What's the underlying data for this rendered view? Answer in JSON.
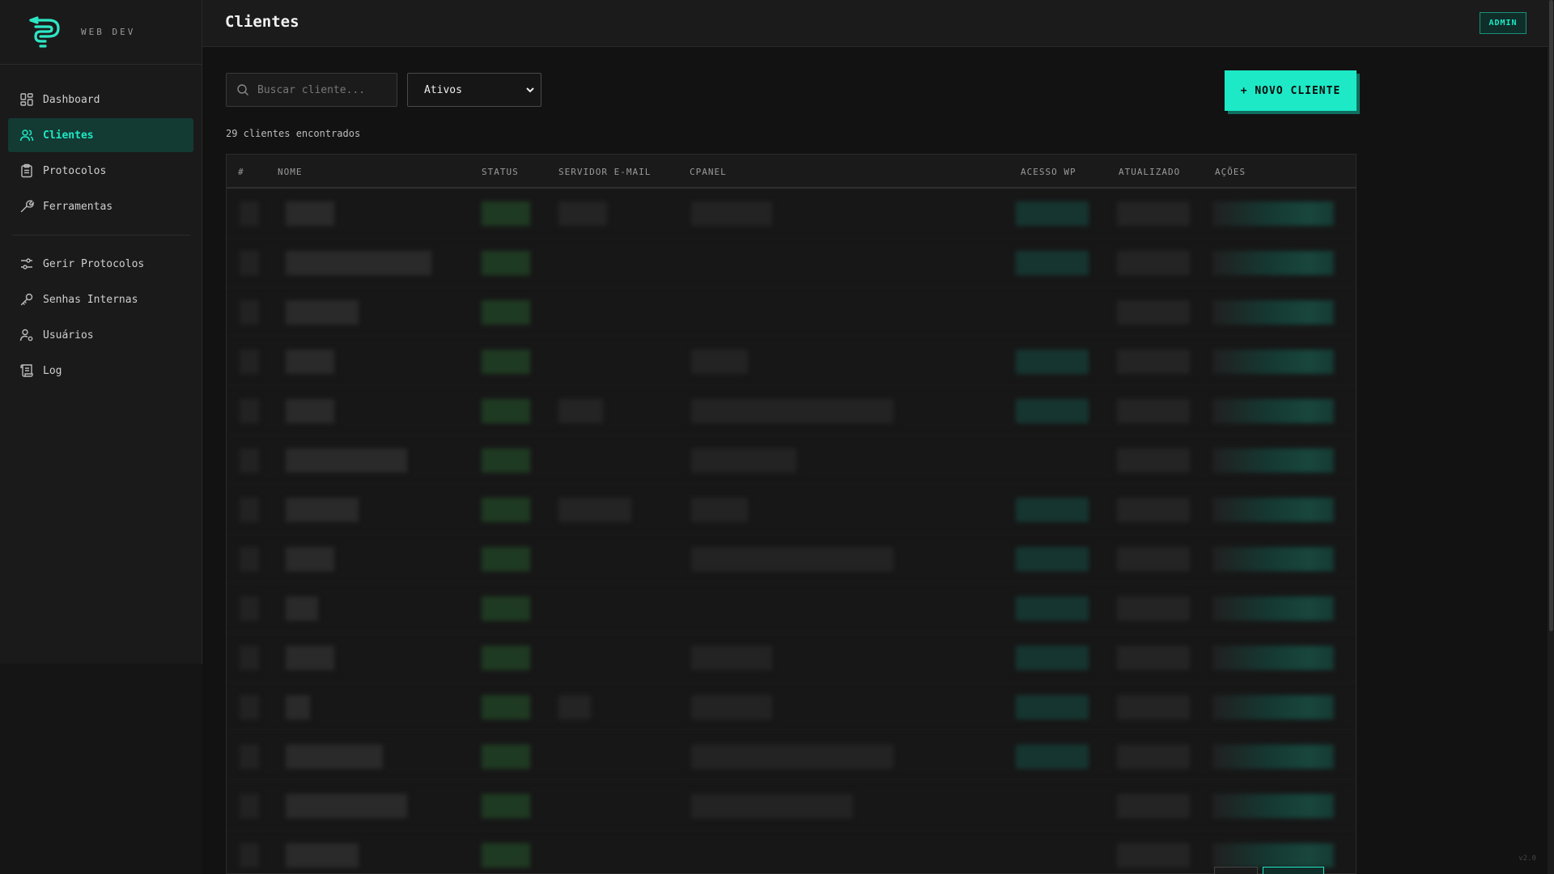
{
  "brand": {
    "text": "WEB DEV",
    "accent": "#1de9c6"
  },
  "sidebar": {
    "items": [
      {
        "label": "Dashboard",
        "icon": "grid-icon",
        "active": false
      },
      {
        "label": "Clientes",
        "icon": "users-icon",
        "active": true
      },
      {
        "label": "Protocolos",
        "icon": "clipboard-icon",
        "active": false
      },
      {
        "label": "Ferramentas",
        "icon": "wrench-icon",
        "active": false
      }
    ],
    "admin_items": [
      {
        "label": "Gerir Protocolos",
        "icon": "sliders-icon"
      },
      {
        "label": "Senhas Internas",
        "icon": "key-icon"
      },
      {
        "label": "Usuários",
        "icon": "user-cog-icon"
      },
      {
        "label": "Log",
        "icon": "scroll-icon"
      }
    ]
  },
  "header": {
    "title": "Clientes",
    "role_badge": "ADMIN"
  },
  "toolbar": {
    "search_placeholder": "Buscar cliente...",
    "filter_value": "Ativos",
    "new_button": "+ NOVO CLIENTE"
  },
  "summary": {
    "count_text": "29 clientes encontrados"
  },
  "table": {
    "columns": [
      "#",
      "NOME",
      "STATUS",
      "SERVIDOR E-MAIL",
      "CPANEL",
      "ACESSO WP",
      "ATUALIZADO",
      "AÇÕES"
    ]
  },
  "footer": {
    "version": "v2.0"
  }
}
